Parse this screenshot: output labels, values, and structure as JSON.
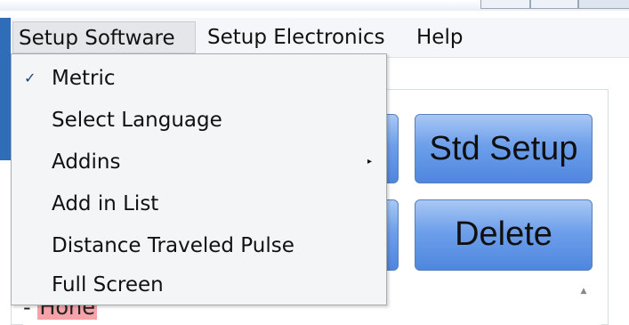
{
  "menubar": {
    "items": [
      {
        "label": "Setup Software"
      },
      {
        "label": "Setup Electronics"
      },
      {
        "label": "Help"
      }
    ]
  },
  "dropdown": {
    "items": [
      {
        "label": "Metric",
        "checked": true
      },
      {
        "label": "Select Language"
      },
      {
        "label": "Addins",
        "submenu": true
      },
      {
        "label": "Add in List"
      },
      {
        "label": "Distance Traveled Pulse"
      },
      {
        "label": "Full Screen"
      }
    ],
    "check_glyph": "✓",
    "submenu_glyph": "▸"
  },
  "buttons": {
    "std_setup": "Std Setup",
    "delete": "Delete"
  },
  "list": {
    "row_bullet": "-",
    "row_text": "Hone"
  },
  "colors": {
    "button_blue": "#6d9fea",
    "highlight_pink": "#f4a3a8",
    "menu_bg": "#f4f5f7"
  }
}
